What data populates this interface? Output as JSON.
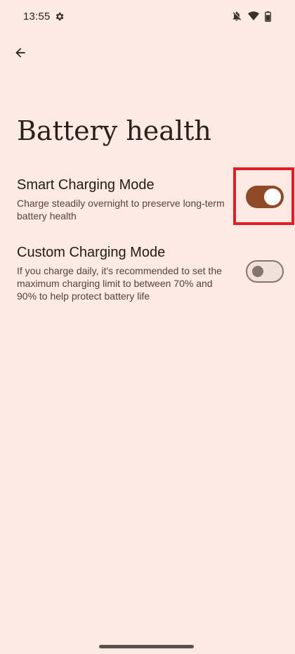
{
  "status_bar": {
    "time": "13:55",
    "icons": [
      "settings-gear-icon",
      "mute-icon",
      "wifi-icon",
      "battery-icon"
    ]
  },
  "nav": {
    "back_icon": "arrow-left-icon"
  },
  "page": {
    "title": "Battery health"
  },
  "settings": [
    {
      "title": "Smart Charging Mode",
      "description": "Charge steadily overnight to preserve long-term battery health",
      "enabled": true
    },
    {
      "title": "Custom Charging Mode",
      "description": "If you charge daily, it's recommended to set the maximum charging limit to between 70% and 90% to help protect battery life",
      "enabled": false
    }
  ],
  "colors": {
    "background": "#fdeae2",
    "toggle_on_track": "#8f4a27",
    "toggle_off_outline": "#86746d",
    "highlight": "#e11e26"
  }
}
